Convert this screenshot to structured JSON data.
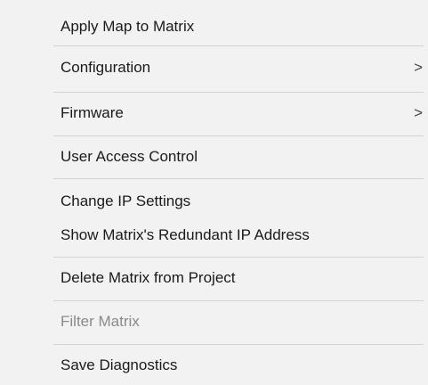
{
  "menu": {
    "items": [
      {
        "label": "Apply Map to Matrix"
      },
      {
        "label": "Configuration",
        "submenu_glyph": ">"
      },
      {
        "label": "Firmware",
        "submenu_glyph": ">"
      },
      {
        "label": "User Access Control"
      },
      {
        "label": "Change IP Settings"
      },
      {
        "label": "Show Matrix's Redundant IP Address"
      },
      {
        "label": "Delete Matrix from Project"
      },
      {
        "label": "Filter Matrix",
        "state": "disabled"
      },
      {
        "label": "Save Diagnostics"
      }
    ]
  }
}
